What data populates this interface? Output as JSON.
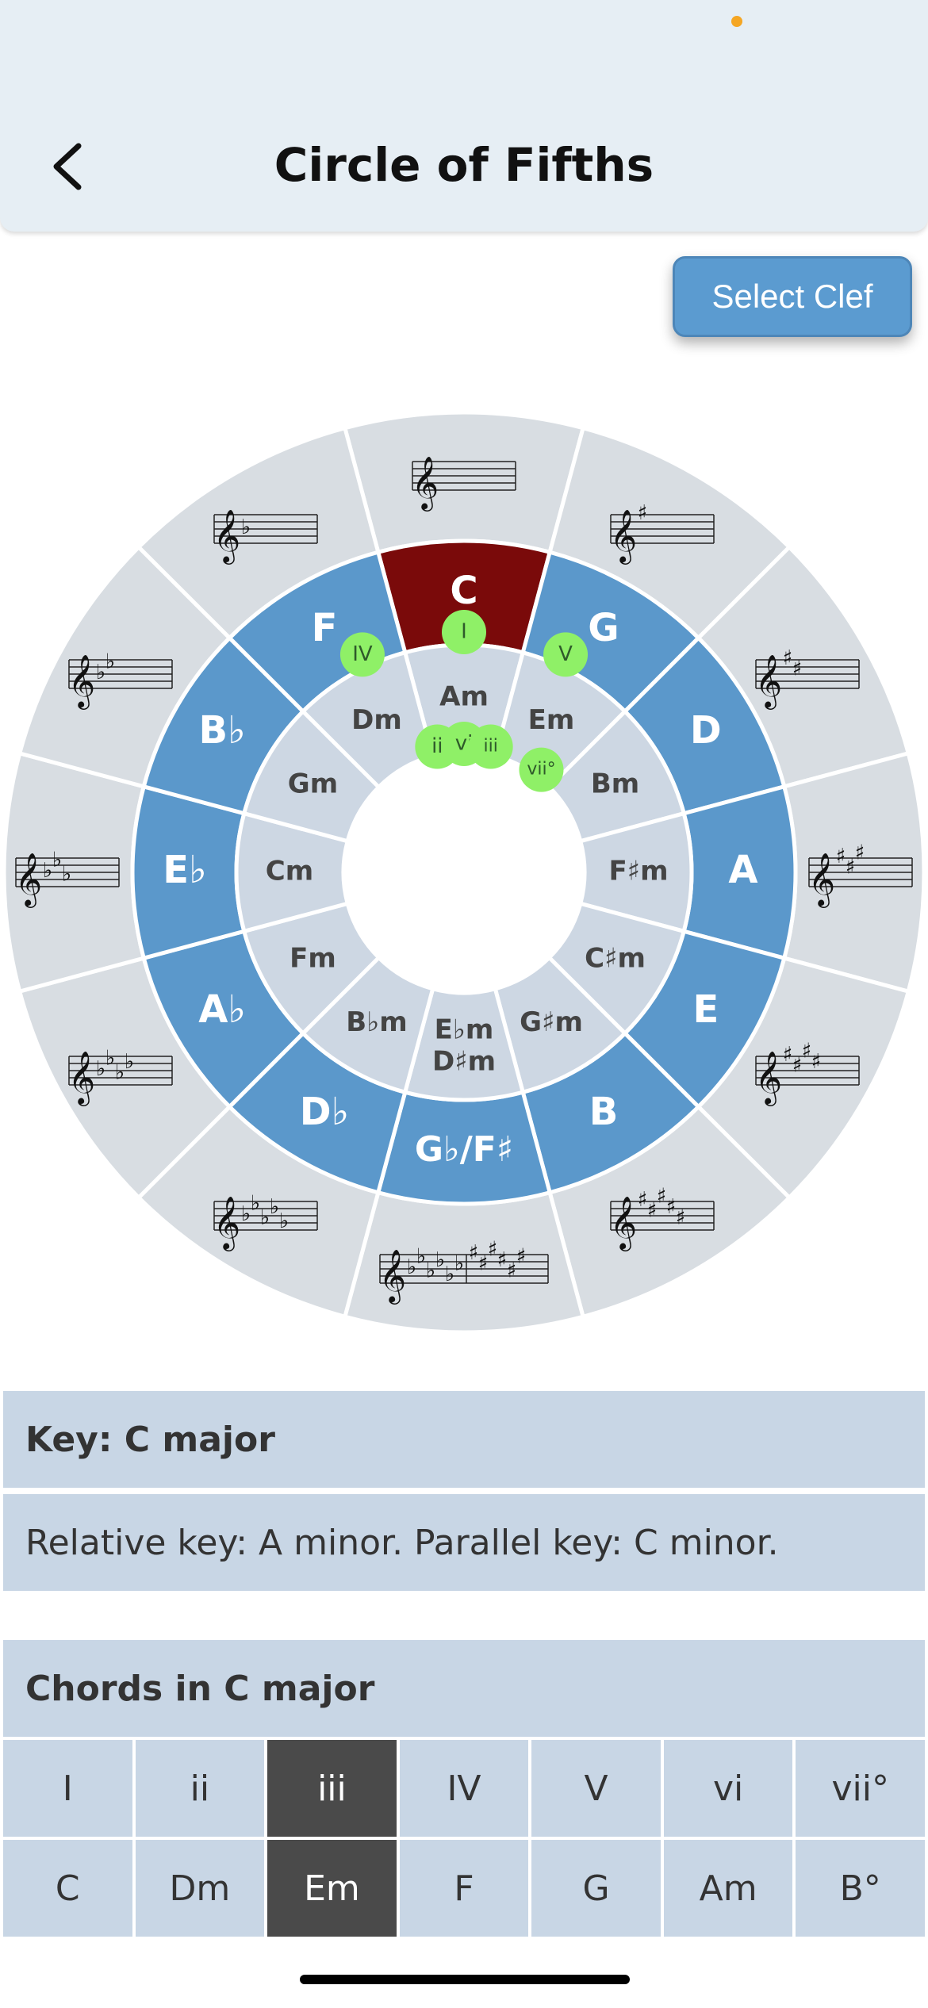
{
  "header": {
    "title": "Circle of Fifths",
    "back_icon": "chevron-left-icon"
  },
  "toolbar": {
    "select_clef_label": "Select Clef"
  },
  "wheel": {
    "colors": {
      "outer_ring": "#d8dde2",
      "major_ring": "#5b98cb",
      "minor_ring": "#cdd7e3",
      "selected_major": "#7a0a0a",
      "degree_badge": "#8ff067",
      "center": "#ffffff"
    },
    "major_keys": [
      "C",
      "G",
      "D",
      "A",
      "E",
      "B",
      "G♭/F♯",
      "D♭",
      "A♭",
      "E♭",
      "B♭",
      "F"
    ],
    "minor_keys": [
      "Am",
      "Em",
      "Bm",
      "F♯m",
      "C♯m",
      "G♯m",
      "E♭m|D♯m",
      "B♭m",
      "Fm",
      "Cm",
      "Gm",
      "Dm"
    ],
    "key_signatures": [
      {
        "type": "none",
        "count": 0
      },
      {
        "type": "sharp",
        "count": 1
      },
      {
        "type": "sharp",
        "count": 2
      },
      {
        "type": "sharp",
        "count": 3
      },
      {
        "type": "sharp",
        "count": 4
      },
      {
        "type": "sharp",
        "count": 5
      },
      {
        "type": "both",
        "flats": 6,
        "sharps": 6
      },
      {
        "type": "flat",
        "count": 5
      },
      {
        "type": "flat",
        "count": 4
      },
      {
        "type": "flat",
        "count": 3
      },
      {
        "type": "flat",
        "count": 2
      },
      {
        "type": "flat",
        "count": 1
      }
    ],
    "selected_index": 0,
    "major_degree_badges": [
      {
        "index": 0,
        "label": "I"
      },
      {
        "index": 1,
        "label": "V"
      },
      {
        "index": 11,
        "label": "IV"
      }
    ],
    "minor_degree_badges": [
      {
        "index": 11,
        "label": "ii"
      },
      {
        "index": 0,
        "label": "vi"
      },
      {
        "index": 1,
        "label": "iii"
      },
      {
        "index": 2,
        "label": "vii°"
      }
    ]
  },
  "info": {
    "key_label": "Key: C major",
    "relative_text": "Relative key: A minor. Parallel key: C minor."
  },
  "chords": {
    "heading": "Chords in C major",
    "degrees": [
      "I",
      "ii",
      "iii",
      "IV",
      "V",
      "vi",
      "vii°"
    ],
    "names": [
      "C",
      "Dm",
      "Em",
      "F",
      "G",
      "Am",
      "B°"
    ],
    "selected_index": 2
  }
}
